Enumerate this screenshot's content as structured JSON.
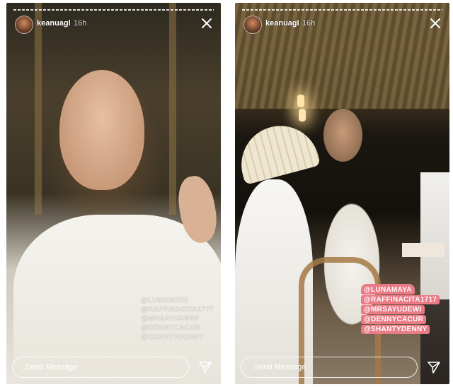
{
  "stories": [
    {
      "username": "keanuagl",
      "time_ago": "16h",
      "mentions": [
        "@LUNAMAYA",
        "@RAFFINACITA1777",
        "@MRSAYUDEWI",
        "@DENNYCACUR",
        "@SHANTYDENNY"
      ],
      "reply_placeholder": "Send Message"
    },
    {
      "username": "keanuagl",
      "time_ago": "16h",
      "mentions": [
        "@LUNAMAYA",
        "@RAFFINACITA1717",
        "@MRSAYUDEWI",
        "@DENNYCACUR",
        "@SHANTYDENNY"
      ],
      "reply_placeholder": "Send Message"
    }
  ],
  "icons": {
    "close": "close-icon",
    "send": "send-icon",
    "avatar": "avatar"
  },
  "colors": {
    "mention_highlight": "#ea7a86",
    "text": "#ffffff"
  }
}
